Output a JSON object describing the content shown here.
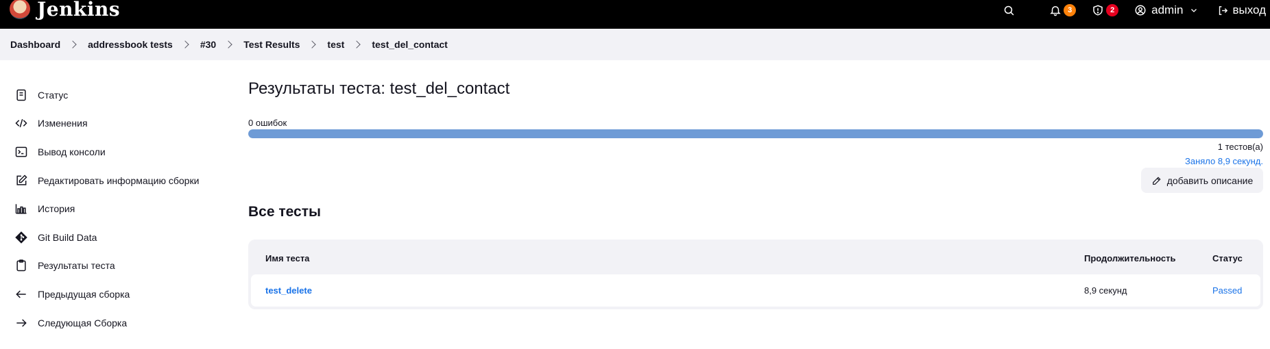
{
  "header": {
    "brand": "Jenkins",
    "notifications_count": "3",
    "security_count": "2",
    "user": "admin",
    "logout": "выход"
  },
  "breadcrumbs": [
    "Dashboard",
    "addressbook tests",
    "#30",
    "Test Results",
    "test",
    "test_del_contact"
  ],
  "sidebar": {
    "items": [
      {
        "label": "Статус",
        "icon": "document-icon"
      },
      {
        "label": "Изменения",
        "icon": "code-icon"
      },
      {
        "label": "Вывод консоли",
        "icon": "terminal-icon"
      },
      {
        "label": "Редактировать информацию сборки",
        "icon": "edit-icon"
      },
      {
        "label": "История",
        "icon": "history-icon"
      },
      {
        "label": "Git Build Data",
        "icon": "git-icon"
      },
      {
        "label": "Результаты теста",
        "icon": "clipboard-icon"
      },
      {
        "label": "Предыдущая сборка",
        "icon": "arrow-left-icon"
      },
      {
        "label": "Следующая Сборка",
        "icon": "arrow-right-icon"
      }
    ]
  },
  "main": {
    "title": "Результаты теста: test_del_contact",
    "fail_count": "0 ошибок",
    "progress_fraction": 1.0,
    "test_count": "1 тестов(а)",
    "took": "Заняло 8,9 секунд.",
    "add_description": "добавить описание",
    "section_title": "Все тесты",
    "table": {
      "headers": [
        "Имя теста",
        "Продолжительность",
        "Статус"
      ],
      "rows": [
        {
          "name": "test_delete",
          "duration": "8,9 секунд",
          "status": "Passed"
        }
      ]
    }
  },
  "colors": {
    "header_bg": "#000000",
    "progress": "#6e9bd6",
    "link": "#1a73e8",
    "badge_orange": "#fe820a",
    "badge_red": "#e6001f"
  }
}
